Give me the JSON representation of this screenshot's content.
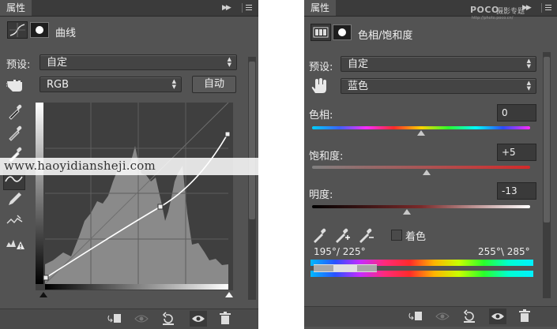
{
  "curves_panel": {
    "tab_label": "属性",
    "title": "曲线",
    "preset_label": "预设:",
    "preset_value": "自定",
    "channel_value": "RGB",
    "auto_button": "自动"
  },
  "hue_panel": {
    "tab_label": "属性",
    "title": "色相/饱和度",
    "preset_label": "预设:",
    "preset_value": "自定",
    "channel_value": "蓝色",
    "hue_label": "色相:",
    "hue_value": "0",
    "hue_level": 0,
    "saturation_label": "饱和度:",
    "saturation_value": "+5",
    "saturation_level": 5,
    "lightness_label": "明度:",
    "lightness_value": "-13",
    "lightness_level": -13,
    "colorize_label": "着色",
    "colorize_checked": false,
    "range_left": "195°/ 225°",
    "range_right": "255°\\ 285°"
  },
  "watermark_text": "www.haoyidiansheji.com",
  "logo": {
    "brand": "POCO",
    "name": "摄影专题",
    "url": "http://photo.poco.cn/"
  },
  "colors": {
    "panel_bg": "#535353",
    "tab_bar": "#3b3b3b",
    "field_bg": "#3a3a3a",
    "text": "#e6e6e6",
    "curve": "#ffffff",
    "histogram": "#8a8a8a"
  },
  "icons": {
    "adjustment_curves": "curves-icon",
    "mask": "mask-icon",
    "targeted_adjust": "hand-pointer-icon",
    "eyedropper": "eyedropper-icon",
    "clip": "clip-to-layer-icon",
    "view_previous": "view-previous-icon",
    "reset": "reset-icon",
    "visibility": "eye-icon",
    "delete": "trash-icon"
  }
}
